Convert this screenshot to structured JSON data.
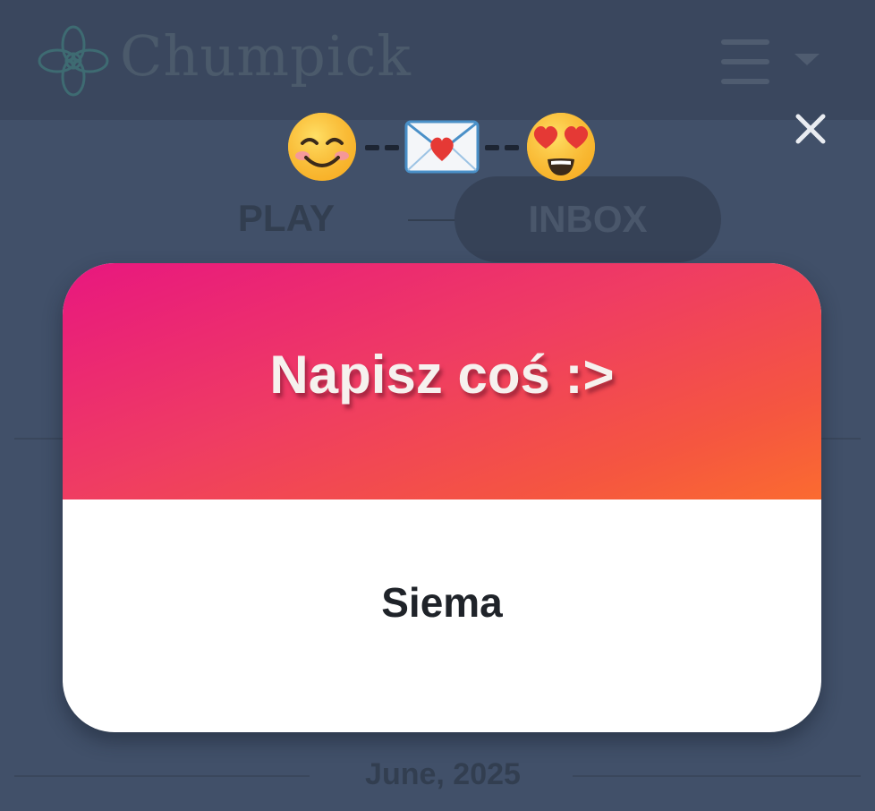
{
  "app": {
    "brand_name": "Chumpick"
  },
  "tabs": {
    "play_label": "PLAY",
    "inbox_label": "INBOX"
  },
  "feed": {
    "date_header": "June, 2025"
  },
  "modal": {
    "emoji_sequence": [
      "smiling-face-icon",
      "love-letter-icon",
      "heart-eyes-face-icon"
    ],
    "title": "Napisz coś :>",
    "message": "Siema",
    "colors": {
      "header_gradient_start": "#e8177f",
      "header_gradient_end": "#fb6b30",
      "title_text": "#f6f1ee",
      "message_text": "#1f2329",
      "overlay_bg": "#415069"
    }
  }
}
